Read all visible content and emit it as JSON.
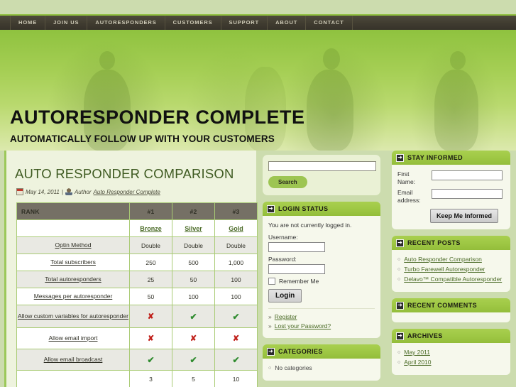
{
  "nav": {
    "items": [
      {
        "label": "HOME"
      },
      {
        "label": "JOIN US"
      },
      {
        "label": "AUTORESPONDERS"
      },
      {
        "label": "CUSTOMERS"
      },
      {
        "label": "SUPPORT"
      },
      {
        "label": "ABOUT"
      },
      {
        "label": "CONTACT"
      }
    ]
  },
  "banner": {
    "title": "AUTORESPONDER COMPLETE",
    "subtitle": "AUTOMATICALLY FOLLOW UP WITH YOUR CUSTOMERS"
  },
  "post": {
    "title": "AUTO RESPONDER COMPARISON",
    "date": "May 14, 2011",
    "separator": "|",
    "author_label": "Author",
    "author_name": "Auto Responder Complete",
    "calendar_icon": "calendar-icon",
    "author_icon": "author-icon"
  },
  "table": {
    "headers": [
      "RANK",
      "#1",
      "#2",
      "#3"
    ],
    "tiers": [
      "Bronze",
      "Silver",
      "Gold"
    ],
    "rows": [
      {
        "label": "Optin Method",
        "values": [
          "Double",
          "Double",
          "Double"
        ]
      },
      {
        "label": "Total subscribers",
        "values": [
          "250",
          "500",
          "1,000"
        ]
      },
      {
        "label": "Total autoresponders",
        "values": [
          "25",
          "50",
          "100"
        ]
      },
      {
        "label": "Messages per autoresponder",
        "values": [
          "50",
          "100",
          "100"
        ]
      },
      {
        "label": "Allow custom variables for autoresponder",
        "values": [
          "✘",
          "✔",
          "✔"
        ]
      },
      {
        "label": "Allow email import",
        "values": [
          "✘",
          "✘",
          "✘"
        ]
      },
      {
        "label": "Allow email broadcast",
        "values": [
          "✔",
          "✔",
          "✔"
        ]
      },
      {
        "label": "",
        "values": [
          "3",
          "5",
          "10"
        ]
      }
    ]
  },
  "search": {
    "value": "",
    "button_label": "Search"
  },
  "login": {
    "panel_title": "LOGIN STATUS",
    "status_text": "You are not currently logged in.",
    "username_label": "Username:",
    "username_value": "",
    "password_label": "Password:",
    "password_value": "",
    "remember_label": "Remember Me",
    "login_button": "Login",
    "links": [
      {
        "label": "Register"
      },
      {
        "label": "Lost your Password?"
      }
    ]
  },
  "categories": {
    "panel_title": "CATEGORIES",
    "items": [
      {
        "label": "No categories"
      }
    ]
  },
  "stay_informed": {
    "panel_title": "STAY INFORMED",
    "first_name_label": "First Name:",
    "first_name_value": "",
    "email_label": "Email address:",
    "email_value": "",
    "button_label": "Keep Me Informed"
  },
  "recent_posts": {
    "panel_title": "RECENT POSTS",
    "items": [
      {
        "label": "Auto Responder Comparison"
      },
      {
        "label": "Turbo Farewell Autoresponder"
      },
      {
        "label": "Delavo™ Compatible Autoresponder"
      }
    ]
  },
  "recent_comments": {
    "panel_title": "RECENT COMMENTS"
  },
  "archives": {
    "panel_title": "ARCHIVES",
    "items": [
      {
        "label": "May 2011"
      },
      {
        "label": "April 2010"
      }
    ]
  },
  "colors": {
    "green_accent": "#9ec744",
    "banner_green": "#8fc23f",
    "link_green": "#4b6b27",
    "check_green": "#2f8b2f",
    "cross_red": "#c0201a",
    "nav_dark": "#413d31"
  }
}
